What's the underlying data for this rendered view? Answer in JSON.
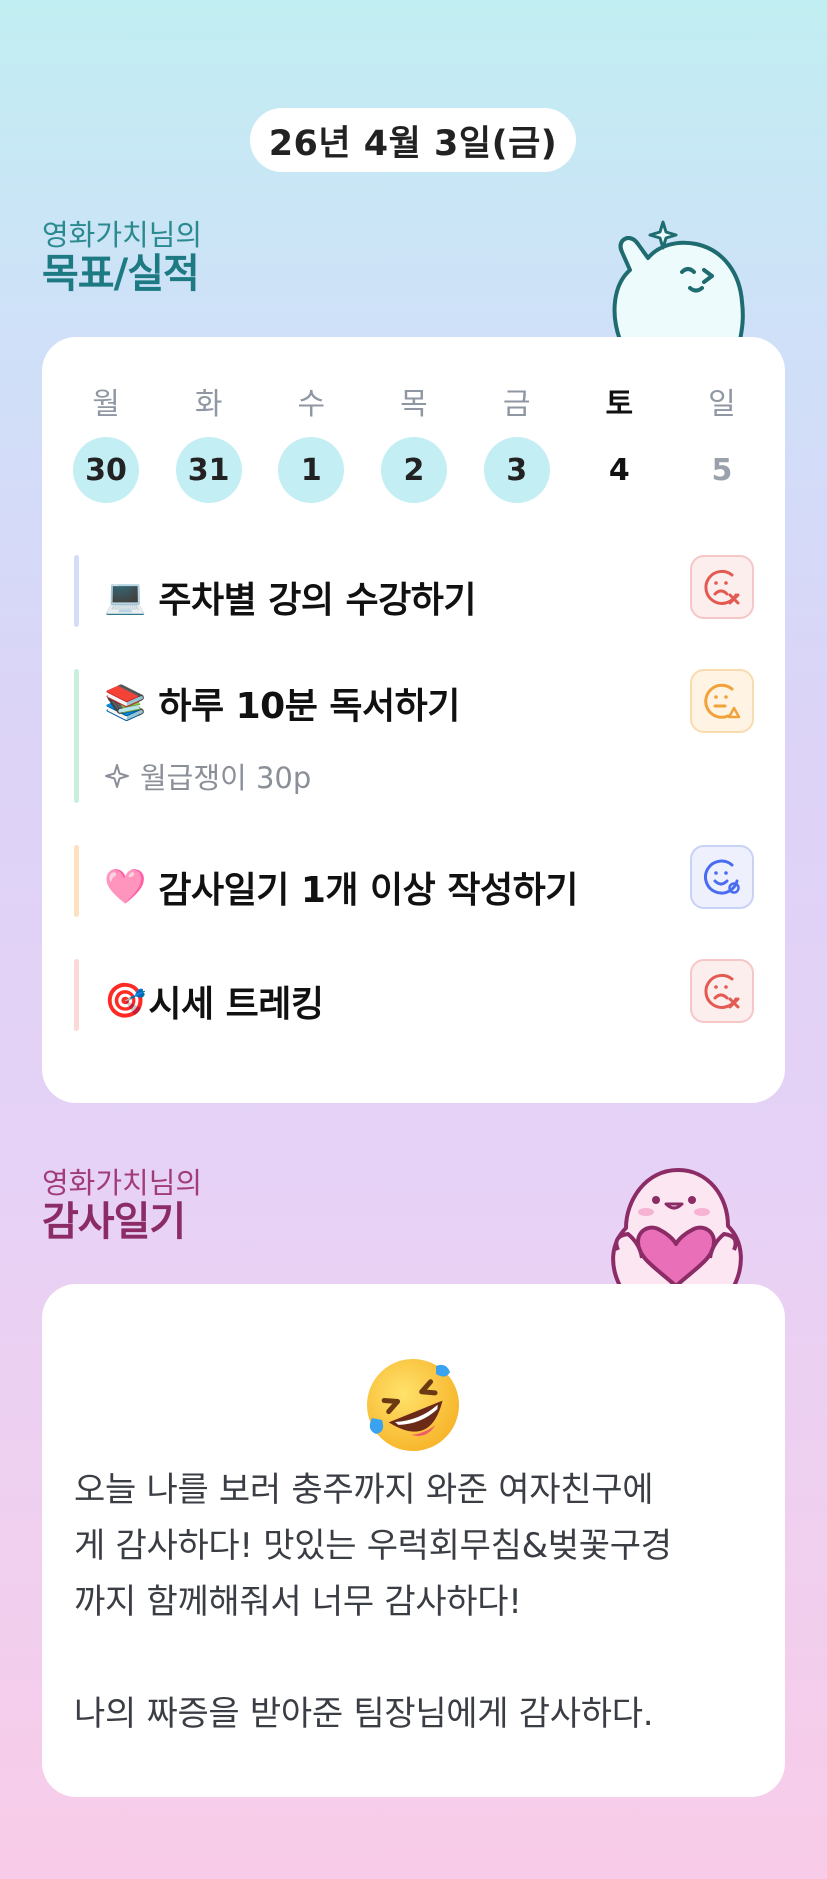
{
  "date": "26년 4월 3일(금)",
  "goals_section": {
    "owner": "영화가치님의",
    "title": "목표/실적"
  },
  "week": [
    {
      "name": "월",
      "num": "30",
      "done": true
    },
    {
      "name": "화",
      "num": "31",
      "done": true
    },
    {
      "name": "수",
      "num": "1",
      "done": true
    },
    {
      "name": "목",
      "num": "2",
      "done": true
    },
    {
      "name": "금",
      "num": "3",
      "done": true
    },
    {
      "name": "토",
      "num": "4",
      "done": false
    },
    {
      "name": "일",
      "num": "5",
      "done": false
    }
  ],
  "goals": [
    {
      "emoji": "💻",
      "text": "주차별 강의 수강하기",
      "status": "fail",
      "bar_color": "#d6dcf8",
      "status_icon": "sad-x-face-icon"
    },
    {
      "emoji": "📚",
      "text": "하루 10분 독서하기",
      "reward": "월급쟁이 30p",
      "status": "warn",
      "bar_color": "#c9eedd",
      "status_icon": "meh-triangle-face-icon"
    },
    {
      "emoji": "🩷",
      "text": "감사일기 1개 이상 작성하기",
      "status": "ok",
      "bar_color": "#fde1c0",
      "status_icon": "smile-circle-face-icon"
    },
    {
      "emoji": "🎯",
      "text": "시세 트레킹",
      "status": "fail",
      "bar_color": "#fbd9d6",
      "status_icon": "sad-x-face-icon"
    }
  ],
  "gratitude_section": {
    "owner": "영화가치님의",
    "title": "감사일기"
  },
  "gratitude": {
    "emoji_icon": "rolling-laughing-face-icon",
    "text": "오늘 나를 보러 충주까지 와준 여자친구에\n게 감사하다! 맛있는 우럭회무침&벚꽃구경\n까지 함께해줘서 너무 감사하다!\n\n나의 짜증을 받아준 팀장님에게 감사하다."
  },
  "colors": {
    "done_circle": "#c3eef3",
    "fail": "#e35a52",
    "warn": "#f1a23a",
    "ok": "#4a6cf0"
  }
}
